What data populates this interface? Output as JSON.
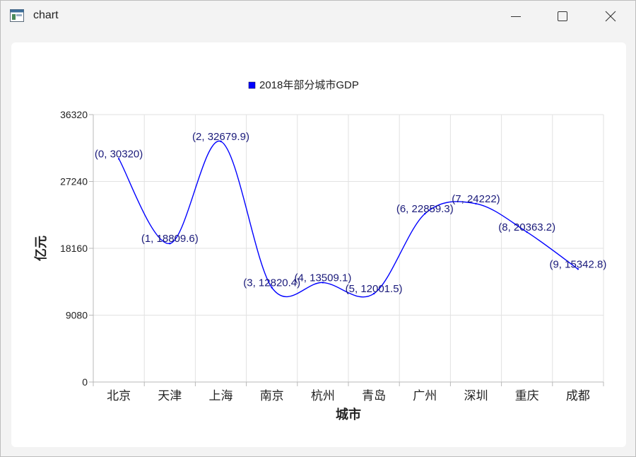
{
  "window": {
    "title": "chart",
    "icons": {
      "app": "app-window-icon",
      "minimize": "minimize-icon",
      "maximize": "maximize-icon",
      "close": "close-icon"
    }
  },
  "colors": {
    "series": "#0000ff",
    "label": "#1a1a7a",
    "grid": "#e2e2e2",
    "axis": "#b9b9b9",
    "text": "#222222"
  },
  "chart_data": {
    "type": "line",
    "smooth": true,
    "legend": {
      "position": "top",
      "entries": [
        "2018年部分城市GDP"
      ]
    },
    "xlabel": "城市",
    "ylabel": "亿元",
    "categories": [
      "北京",
      "天津",
      "上海",
      "南京",
      "杭州",
      "青岛",
      "广州",
      "深圳",
      "重庆",
      "成都"
    ],
    "ylim": [
      0,
      36320
    ],
    "yticks": [
      "0",
      "9080",
      "18160",
      "27240",
      "36320"
    ],
    "grid": true,
    "series": [
      {
        "name": "2018年部分城市GDP",
        "values": [
          30320,
          18809.6,
          32679.9,
          12820.4,
          13509.1,
          12001.5,
          22859.3,
          24222,
          20363.2,
          15342.8
        ],
        "point_labels": [
          "(0, 30320)",
          "(1, 18809.6)",
          "(2, 32679.9)",
          "(3, 12820.4)",
          "(4, 13509.1)",
          "(5, 12001.5)",
          "(6, 22859.3)",
          "(7, 24222)",
          "(8, 20363.2)",
          "(9, 15342.8)"
        ]
      }
    ]
  }
}
